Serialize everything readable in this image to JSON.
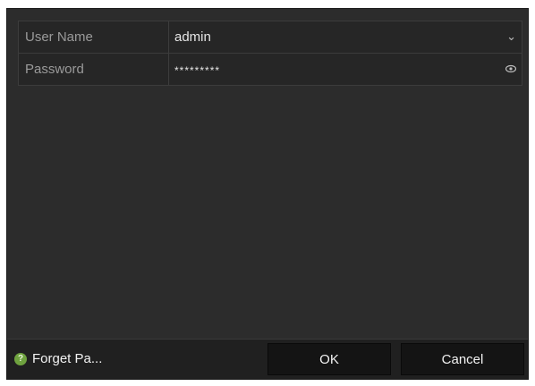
{
  "login": {
    "username_label": "User Name",
    "username_value": "admin",
    "username_dropdown_icon": "chevron-down-icon",
    "password_label": "Password",
    "password_value": "*********",
    "password_toggle_icon": "eye-icon"
  },
  "footer": {
    "forget_password_label": "Forget Pa...",
    "help_icon": "question-icon",
    "help_icon_color": "#6fa23f",
    "ok_label": "OK",
    "cancel_label": "Cancel"
  },
  "colors": {
    "dialog_bg": "#2c2c2c",
    "button_bg": "#141414",
    "text": "#e6e6e6"
  }
}
